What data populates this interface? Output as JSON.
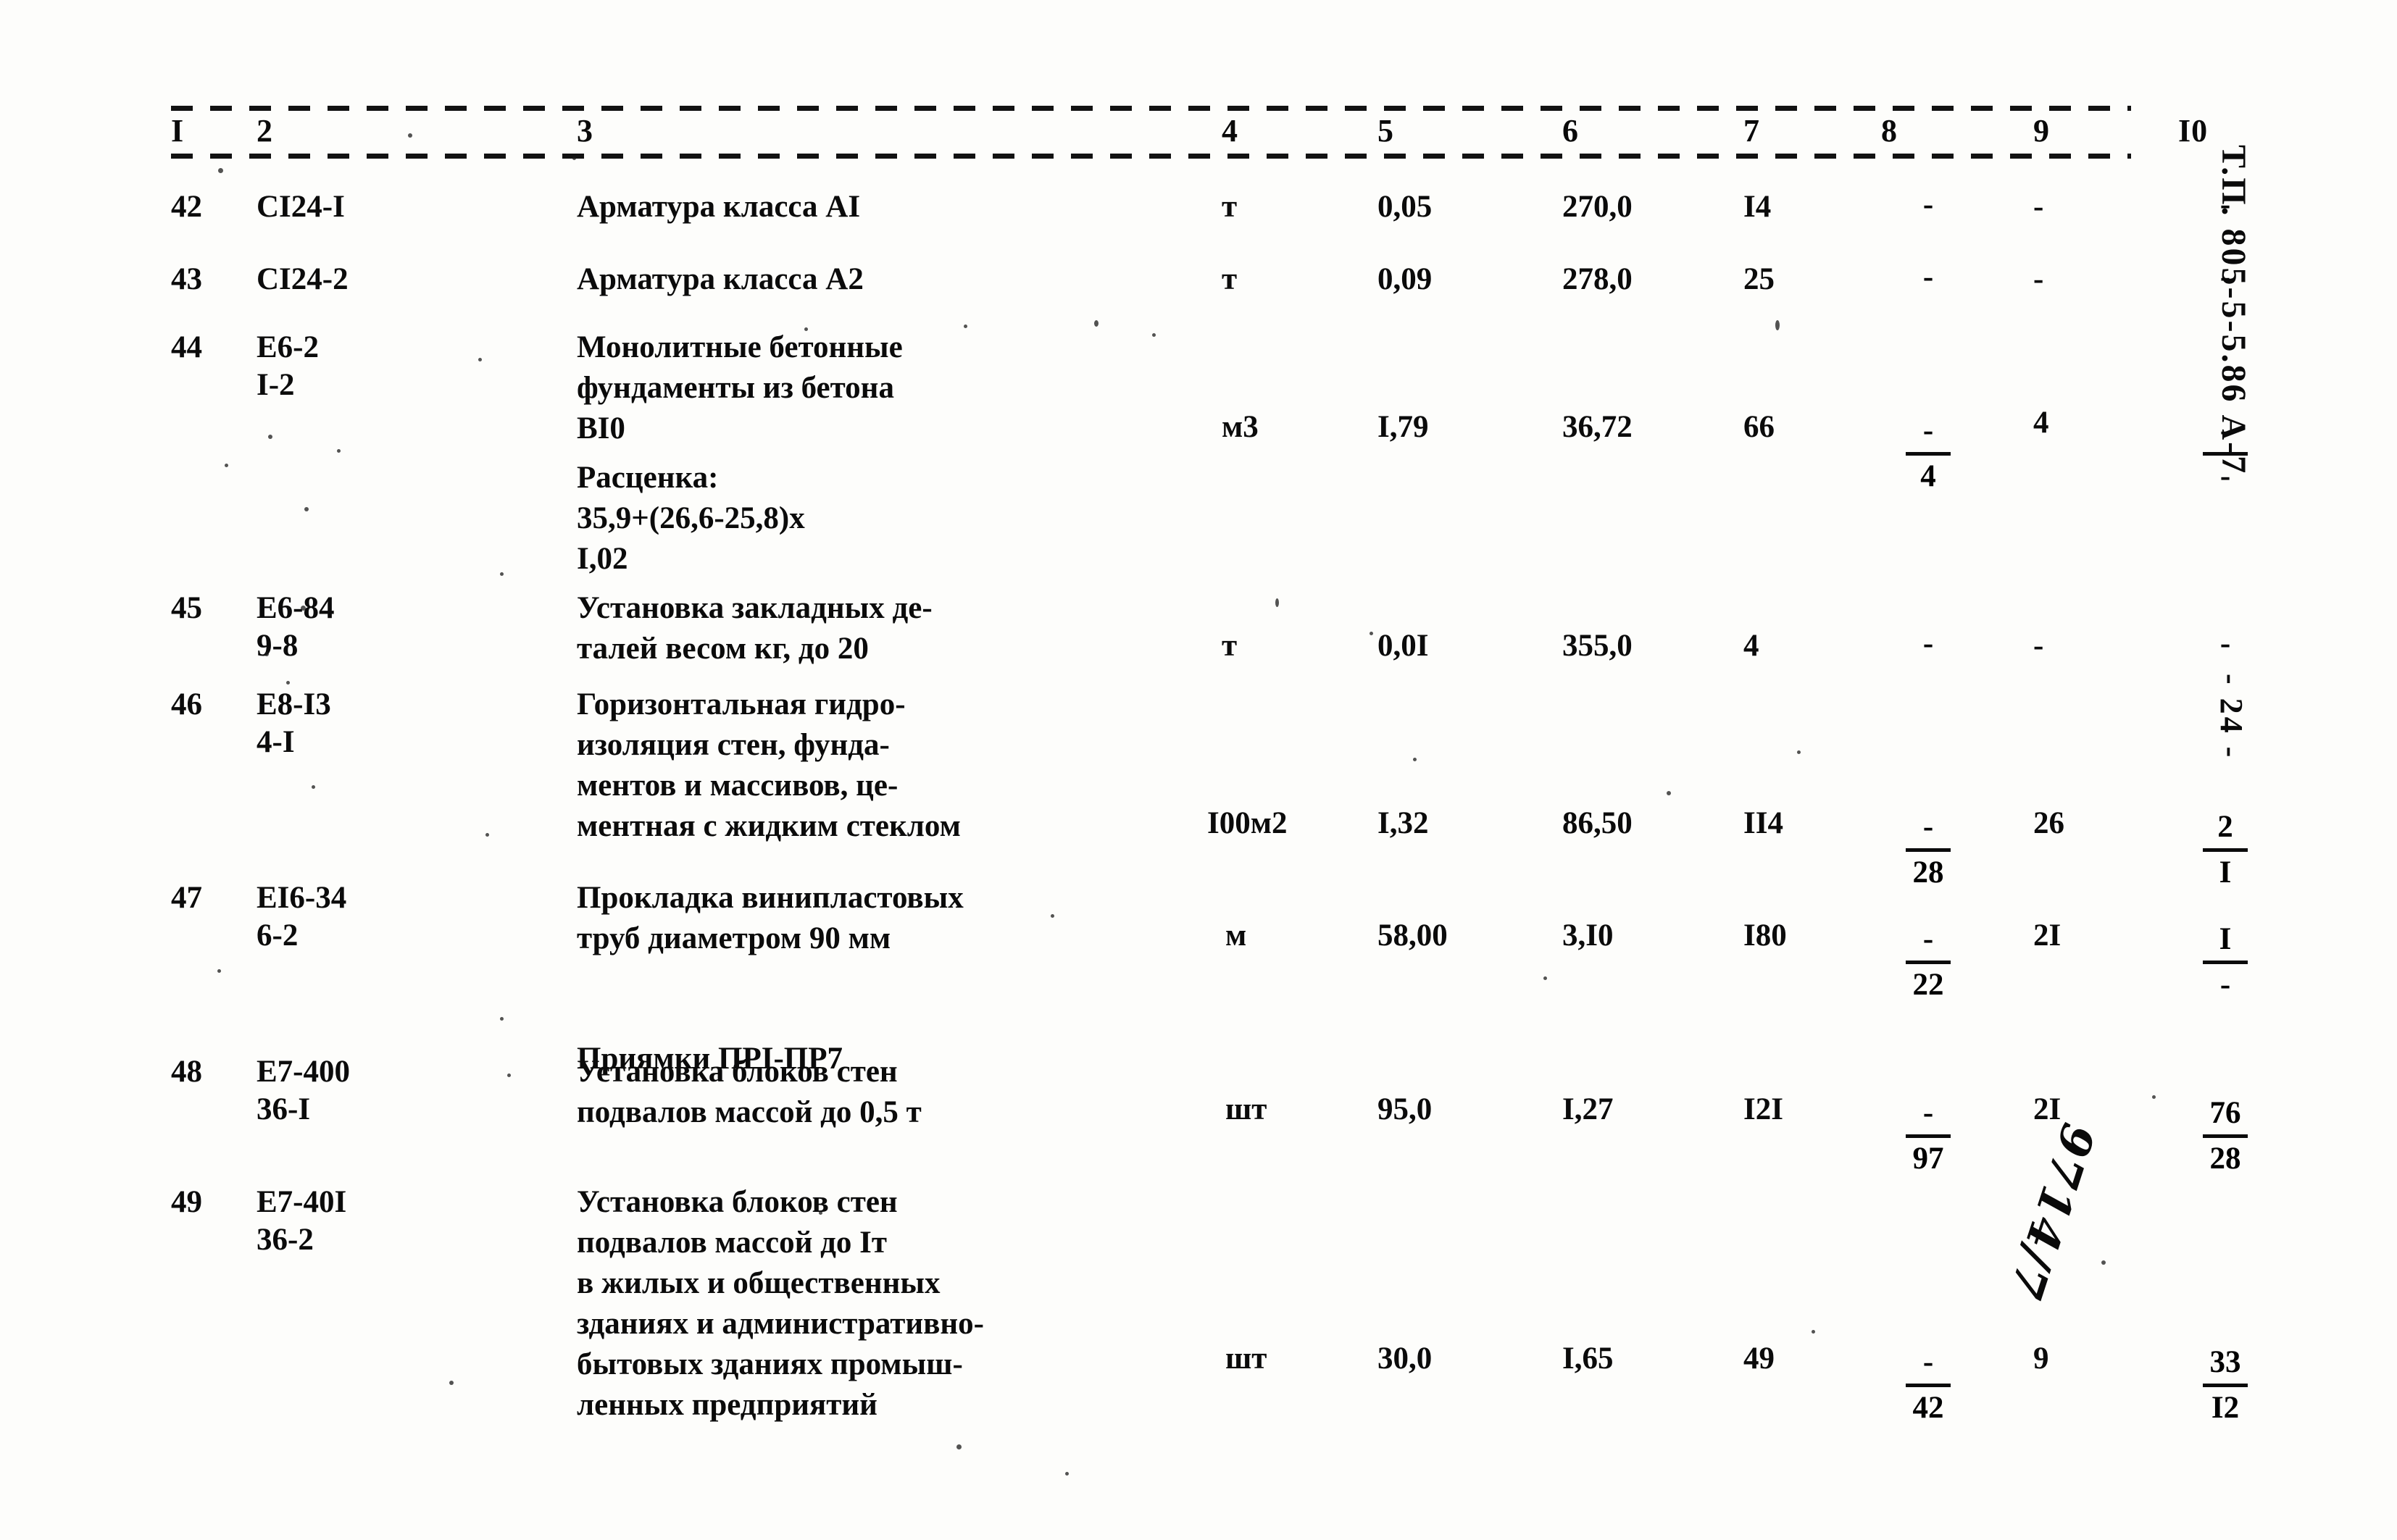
{
  "document": {
    "margin_code": "Т.П. 805-5-5.86 А-7",
    "page_number": "- 24 -",
    "handwritten_annotation": "9714/7"
  },
  "table": {
    "column_headers": [
      "I",
      "2",
      "3",
      "4",
      "5",
      "6",
      "7",
      "8",
      "9",
      "I0"
    ],
    "rows": [
      {
        "num": "42",
        "code": "CI24-I",
        "description": "Арматура класса АI",
        "unit": "т",
        "qty": "0,05",
        "price": "270,0",
        "c7": "I4",
        "c8_top": "-",
        "c8_bot": "",
        "c8_bar": false,
        "c9": "-",
        "c10_top": "-",
        "c10_bot": "",
        "c10_bar": false
      },
      {
        "num": "43",
        "code": "CI24-2",
        "description": "Арматура класса А2",
        "unit": "т",
        "qty": "0,09",
        "price": "278,0",
        "c7": "25",
        "c8_top": "-",
        "c8_bot": "",
        "c8_bar": false,
        "c9": "-",
        "c10_top": "-",
        "c10_bot": "",
        "c10_bar": false
      },
      {
        "num": "44",
        "code": "Е6-2",
        "code2": "I-2",
        "description": "Монолитные бетонные\nфундаменты из бетона\nВI0",
        "extra_note": "Расценка:\n35,9+(26,6-25,8)х\nI,02",
        "unit": "м3",
        "qty": "I,79",
        "price": "36,72",
        "c7": "66",
        "c8_top": "-",
        "c8_bot": "4",
        "c8_bar": true,
        "c9": "4",
        "c10_top": "-",
        "c10_bot": "-",
        "c10_bar": true
      },
      {
        "num": "45",
        "code": "Е6-84",
        "code2": "9-8",
        "description": "Установка закладных де-\nталей весом кг, до 20",
        "unit": "т",
        "qty": "0,0I",
        "price": "355,0",
        "c7": "4",
        "c8_top": "-",
        "c8_bot": "",
        "c8_bar": false,
        "c9": "-",
        "c10_top": "-",
        "c10_bot": "",
        "c10_bar": false
      },
      {
        "num": "46",
        "code": "Е8-I3",
        "code2": "4-I",
        "description": "Горизонтальная гидро-\nизоляция стен, фунда-\nментов и массивов, це-\nментная с жидким стеклом",
        "unit": "I00м2",
        "qty": "I,32",
        "price": "86,50",
        "c7": "II4",
        "c8_top": "-",
        "c8_bot": "28",
        "c8_bar": true,
        "c9": "26",
        "c10_top": "2",
        "c10_bot": "I",
        "c10_bar": true
      },
      {
        "num": "47",
        "code": "ЕI6-34",
        "code2": "6-2",
        "description": "Прокладка винипластовых\nтруб диаметром 90 мм",
        "extra_note": "Приямки ПРI-ПР7",
        "unit": "м",
        "qty": "58,00",
        "price": "3,I0",
        "c7": "I80",
        "c8_top": "-",
        "c8_bot": "22",
        "c8_bar": true,
        "c9": "2I",
        "c10_top": "I",
        "c10_bot": "-",
        "c10_bar": true
      },
      {
        "num": "48",
        "code": "Е7-400",
        "code2": "36-I",
        "description": "Установка блоков стен\nподвалов массой до 0,5 т",
        "unit": "шт",
        "qty": "95,0",
        "price": "I,27",
        "c7": "I2I",
        "c8_top": "-",
        "c8_bot": "97",
        "c8_bar": true,
        "c9": "2I",
        "c10_top": "76",
        "c10_bot": "28",
        "c10_bar": true
      },
      {
        "num": "49",
        "code": "Е7-40I",
        "code2": "36-2",
        "description": "Установка блоков стен\nподвалов массой до Iт\nв жилых и общественных\nзданиях и административно-\nбытовых зданиях промыш-\nленных предприятий",
        "unit": "шт",
        "qty": "30,0",
        "price": "I,65",
        "c7": "49",
        "c8_top": "-",
        "c8_bot": "42",
        "c8_bar": true,
        "c9": "9",
        "c10_top": "33",
        "c10_bot": "I2",
        "c10_bar": true
      }
    ]
  }
}
